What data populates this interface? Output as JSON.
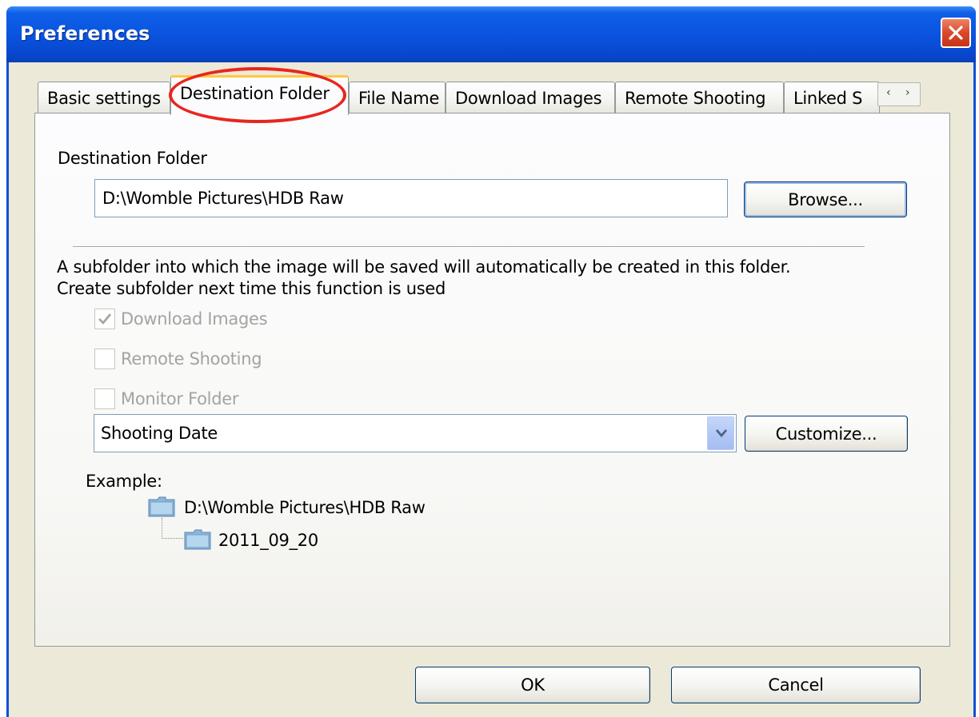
{
  "window": {
    "title": "Preferences"
  },
  "tabs": [
    {
      "label": "Basic settings",
      "active": false
    },
    {
      "label": "Destination Folder",
      "active": true
    },
    {
      "label": "File Name",
      "active": false
    },
    {
      "label": "Download Images",
      "active": false
    },
    {
      "label": "Remote Shooting",
      "active": false
    },
    {
      "label": "Linked S",
      "active": false
    }
  ],
  "tab_scroll": {
    "left": "‹",
    "right": "›"
  },
  "destination": {
    "section_label": "Destination Folder",
    "path": "D:\\Womble Pictures\\HDB Raw",
    "browse_label": "Browse..."
  },
  "subfolder": {
    "description_line1": "A subfolder into which the image will be saved will automatically be created in this folder.",
    "description_line2": "Create subfolder next time this function is used",
    "options": [
      {
        "label": "Download Images",
        "checked": true
      },
      {
        "label": "Remote Shooting",
        "checked": false
      },
      {
        "label": "Monitor Folder",
        "checked": false
      }
    ],
    "naming_selected": "Shooting Date",
    "customize_label": "Customize..."
  },
  "example": {
    "label": "Example:",
    "root": "D:\\Womble Pictures\\HDB Raw",
    "child": "2011_09_20"
  },
  "footer": {
    "ok_label": "OK",
    "cancel_label": "Cancel"
  },
  "colors": {
    "titlebar": "#0a54e0",
    "close_button": "#d9482a",
    "face": "#ece9d8",
    "tab_hot_border": "#ffc83c",
    "annotation": "#e8261f"
  }
}
